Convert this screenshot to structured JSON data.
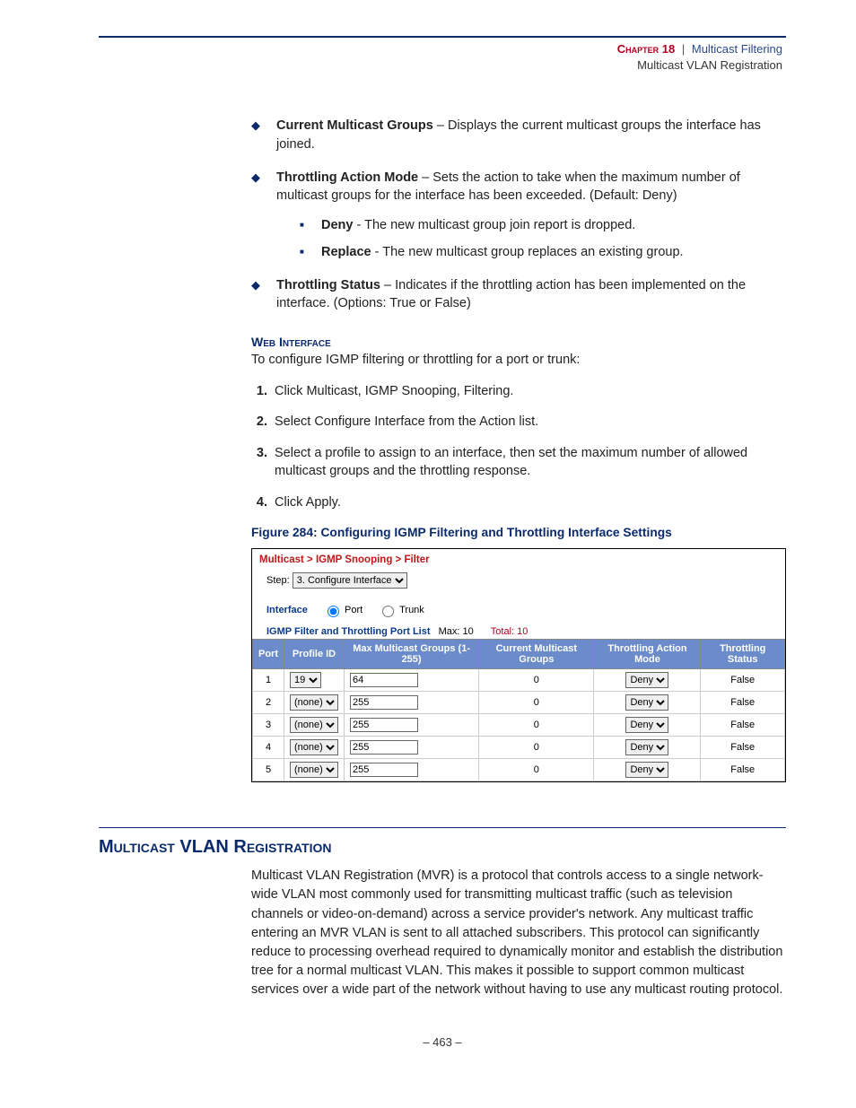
{
  "header": {
    "chapter": "Chapter 18",
    "title1": "Multicast Filtering",
    "title2": "Multicast VLAN Registration"
  },
  "bullets": [
    {
      "term": "Current Multicast Groups",
      "desc": " – Displays the current multicast groups the interface has joined."
    },
    {
      "term": "Throttling Action Mode",
      "desc": " – Sets the action to take when the maximum number of multicast groups for the interface has been exceeded. (Default: Deny)",
      "sub": [
        {
          "term": "Deny",
          "desc": " - The new multicast group join report is dropped."
        },
        {
          "term": "Replace",
          "desc": " - The new multicast group replaces an existing group."
        }
      ]
    },
    {
      "term": "Throttling Status",
      "desc": " – Indicates if the throttling action has been implemented on the interface. (Options: True or False)"
    }
  ],
  "webInterface": {
    "heading": "Web Interface",
    "intro": "To configure IGMP filtering or throttling for a port or trunk:",
    "steps": [
      "Click Multicast, IGMP Snooping, Filtering.",
      "Select Configure Interface from the Action list.",
      "Select a profile to assign to an interface, then set the maximum number of allowed multicast groups and the throttling response.",
      "Click Apply."
    ]
  },
  "figure": {
    "caption": "Figure 284:  Configuring IGMP Filtering and Throttling Interface Settings",
    "breadcrumb": "Multicast > IGMP Snooping > Filter",
    "stepLabel": "Step:",
    "stepValue": "3. Configure Interface",
    "interfaceLabel": "Interface",
    "portLabel": "Port",
    "trunkLabel": "Trunk",
    "listTitle": "IGMP Filter and Throttling Port List",
    "maxLabel": "Max: 10",
    "totalLabel": "Total: 10",
    "cols": [
      "Port",
      "Profile ID",
      "Max Multicast Groups (1-255)",
      "Current Multicast Groups",
      "Throttling Action Mode",
      "Throttling Status"
    ],
    "rows": [
      {
        "port": "1",
        "profile": "19",
        "max": "64",
        "current": "0",
        "action": "Deny",
        "status": "False"
      },
      {
        "port": "2",
        "profile": "(none)",
        "max": "255",
        "current": "0",
        "action": "Deny",
        "status": "False"
      },
      {
        "port": "3",
        "profile": "(none)",
        "max": "255",
        "current": "0",
        "action": "Deny",
        "status": "False"
      },
      {
        "port": "4",
        "profile": "(none)",
        "max": "255",
        "current": "0",
        "action": "Deny",
        "status": "False"
      },
      {
        "port": "5",
        "profile": "(none)",
        "max": "255",
        "current": "0",
        "action": "Deny",
        "status": "False"
      }
    ]
  },
  "section": {
    "title": "Multicast VLAN Registration",
    "body": "Multicast VLAN Registration (MVR) is a protocol that controls access to a single network-wide VLAN most commonly used for transmitting multicast traffic (such as television channels or video-on-demand) across a service provider's network. Any multicast traffic entering an MVR VLAN is sent to all attached subscribers. This protocol can significantly reduce to processing overhead required to dynamically monitor and establish the distribution tree for a normal multicast VLAN. This makes it possible to support common multicast services over a wide part of the network without having to use any multicast routing protocol."
  },
  "pageNum": "–  463  –"
}
